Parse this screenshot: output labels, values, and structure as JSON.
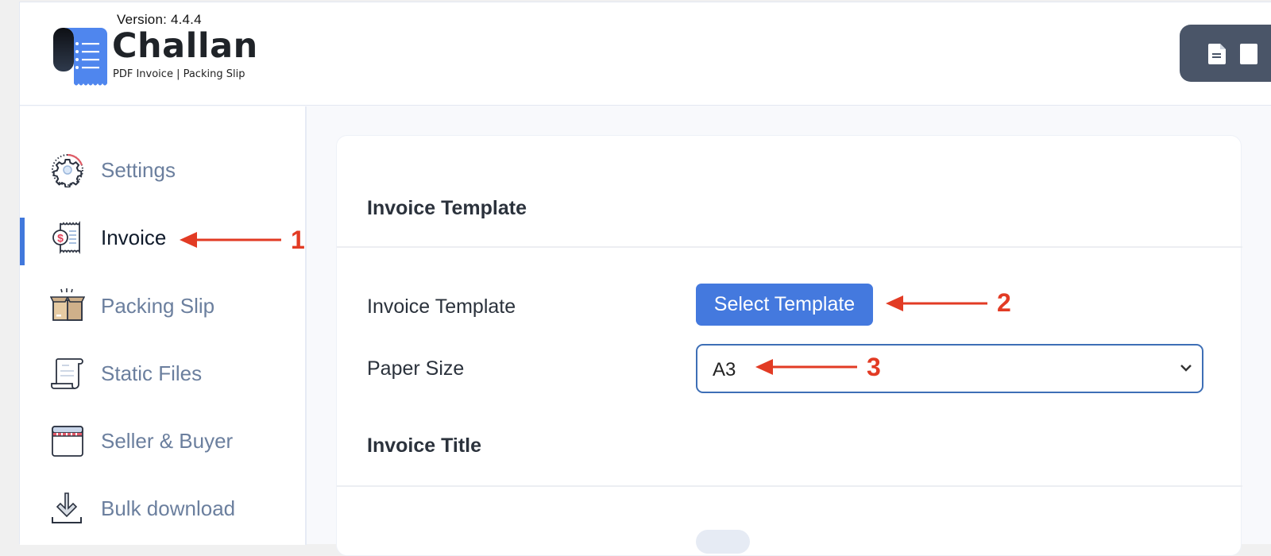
{
  "header": {
    "version": "Version: 4.4.4",
    "brand_name": "Challan",
    "tagline": "PDF Invoice | Packing Slip",
    "logo_icon": "receipt-list-icon",
    "action_button_icon": "document-icon"
  },
  "sidebar": {
    "items": [
      {
        "label": "Settings",
        "icon": "gear-icon",
        "active": false
      },
      {
        "label": "Invoice",
        "icon": "invoice-receipt-icon",
        "active": true
      },
      {
        "label": "Packing Slip",
        "icon": "open-box-icon",
        "active": false
      },
      {
        "label": "Static Files",
        "icon": "scroll-document-icon",
        "active": false
      },
      {
        "label": "Seller & Buyer",
        "icon": "storefront-icon",
        "active": false
      },
      {
        "label": "Bulk download",
        "icon": "download-icon",
        "active": false
      }
    ]
  },
  "main": {
    "section1_title": "Invoice Template",
    "fields": {
      "template_label": "Invoice Template",
      "template_button": "Select Template",
      "paper_size_label": "Paper Size",
      "paper_size_value": "A3"
    },
    "section2_title": "Invoice Title"
  },
  "annotations": [
    {
      "number": "1",
      "target": "Invoice sidebar item"
    },
    {
      "number": "2",
      "target": "Select Template button"
    },
    {
      "number": "3",
      "target": "Paper Size select"
    }
  ],
  "colors": {
    "accent": "#4479de",
    "active_indicator": "#4178dc",
    "annotation": "#e23b24",
    "header_button": "#4a5568",
    "nav_text": "#6b7f9e"
  }
}
